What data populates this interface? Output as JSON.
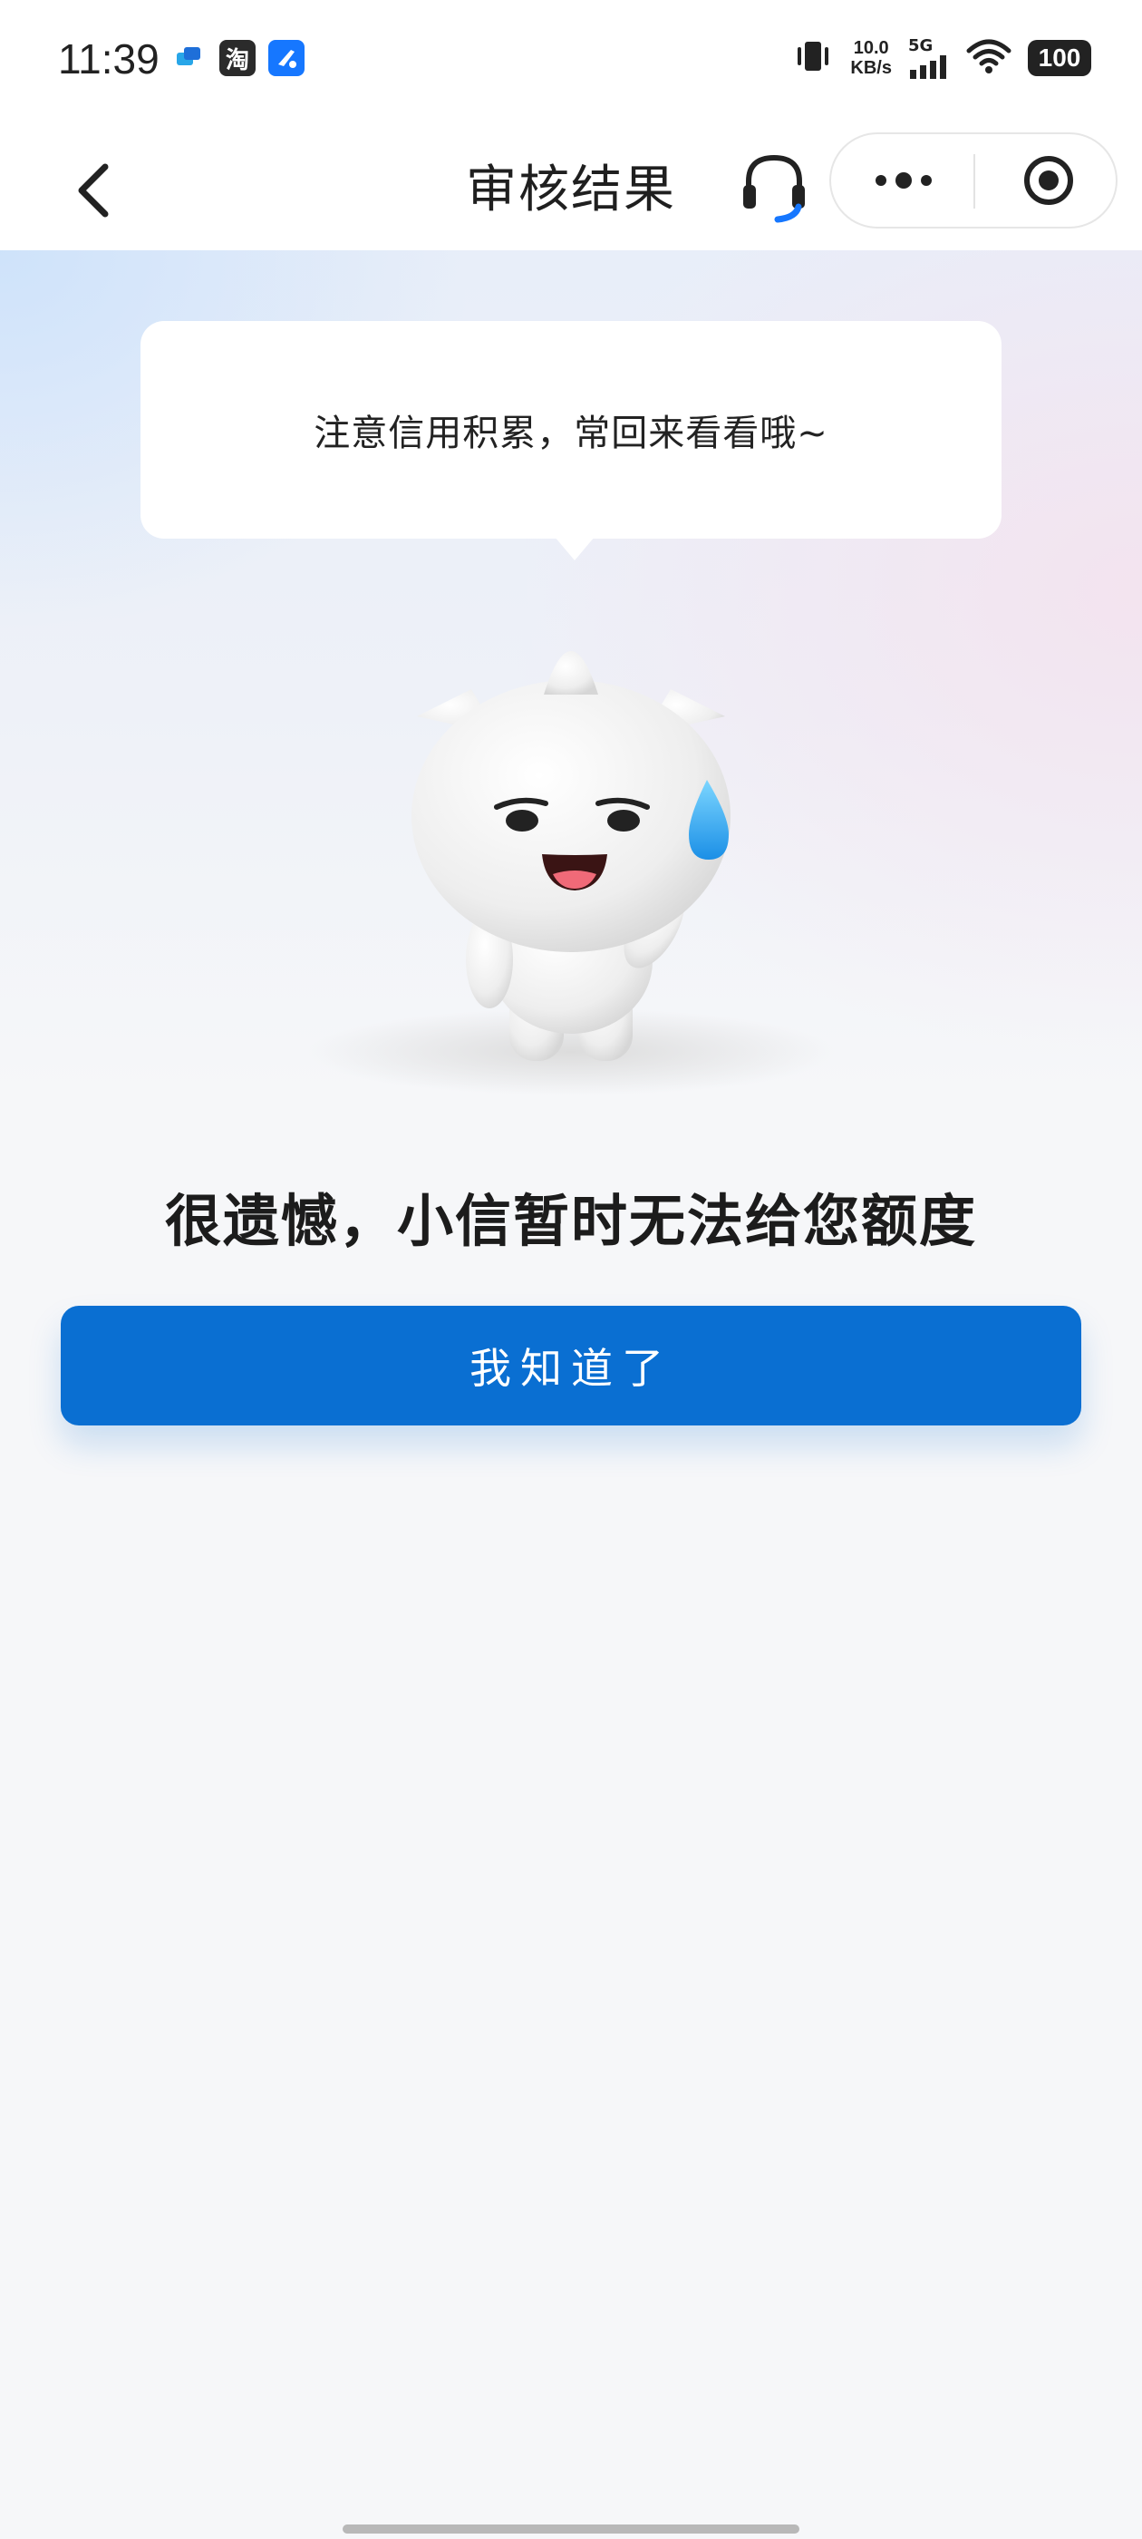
{
  "status_bar": {
    "time": "11:39",
    "app_icons": [
      "chat-app-icon",
      "taobao-icon",
      "feishu-icon"
    ],
    "app_icon_glyphs": [
      "",
      "淘",
      ""
    ],
    "net_speed_value": "10.0",
    "net_speed_unit": "KB/s",
    "network": "5G",
    "battery": "100"
  },
  "nav": {
    "title": "审核结果",
    "back_icon": "chevron-left-icon",
    "service_icon": "headset-icon",
    "more_icon": "more-dots-icon",
    "close_icon": "target-close-icon"
  },
  "main": {
    "bubble_text": "注意信用积累，常回来看看哦~",
    "headline": "很遗憾，小信暂时无法给您额度",
    "primary_button_label": "我知道了"
  },
  "colors": {
    "primary": "#0a6fd2",
    "headset_accent": "#1677ff",
    "text_dark": "#1f1f1f",
    "page_bg": "#f6f7f9"
  }
}
